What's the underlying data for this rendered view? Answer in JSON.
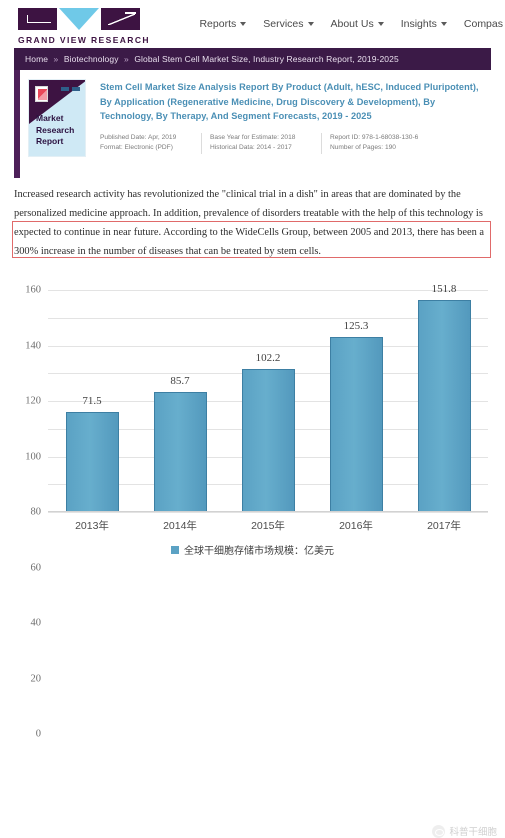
{
  "site": {
    "logo_text": "GRAND VIEW RESEARCH",
    "nav": [
      {
        "label": "Reports",
        "has_caret": true,
        "icon": "chevron-down-icon"
      },
      {
        "label": "Services",
        "has_caret": true,
        "icon": "chevron-down-icon"
      },
      {
        "label": "About Us",
        "has_caret": true,
        "icon": "chevron-down-icon"
      },
      {
        "label": "Insights",
        "has_caret": true,
        "icon": "chevron-down-icon"
      },
      {
        "label": "Compas",
        "has_caret": false,
        "icon": ""
      }
    ],
    "accent_purple": "#3b1a47",
    "accent_cyan": "#6fc9e8",
    "link_blue": "#4a8fb5"
  },
  "breadcrumb": {
    "items": [
      "Home",
      "Biotechnology",
      "Global Stem Cell Market Size, Industry Research Report, 2019-2025"
    ],
    "separator": "»"
  },
  "report": {
    "thumb_title": "Market\nResearch\nReport",
    "thumb_line1": "Market",
    "thumb_line2": "Research",
    "thumb_line3": "Report",
    "title": "Stem Cell Market Size Analysis Report By Product (Adult, hESC, Induced Pluripotent), By Application (Regenerative Medicine, Drug Discovery & Development), By Technology, By Therapy, And Segment Forecasts, 2019 - 2025",
    "meta": {
      "published_date": "Published Date: Apr, 2019",
      "base_year": "Base Year for Estimate: 2018",
      "report_id": "Report ID: 978-1-68038-130-6",
      "format": "Format: Electronic (PDF)",
      "historical_data": "Historical Data: 2014 - 2017",
      "pages": "Number of Pages: 190"
    }
  },
  "body_text": {
    "paragraph": "Increased research activity has revolutionized the \"clinical trial in a dish\" in areas that are dominated by the personalized medicine approach. In addition, prevalence of disorders treatable with the help of this technology is expected to continue in near future. According to the WideCells Group, between 2005 and 2013, there has been a 300% increase in the number of diseases that can be treated by stem cells.",
    "highlight_color": "#e06a6a"
  },
  "chart_data": {
    "type": "bar",
    "title": "",
    "categories": [
      "2013年",
      "2014年",
      "2015年",
      "2016年",
      "2017年"
    ],
    "values": [
      71.5,
      85.7,
      102.2,
      125.3,
      151.8
    ],
    "value_labels": [
      "71.5",
      "85.7",
      "102.2",
      "125.3",
      "151.8"
    ],
    "series": [
      {
        "name": "全球干细胞存储市场规模：亿美元",
        "values": [
          71.5,
          85.7,
          102.2,
          125.3,
          151.8
        ]
      }
    ],
    "legend": [
      "全球干细胞存储市场规模：亿美元"
    ],
    "legend_position": "bottom",
    "xlabel": "",
    "ylabel": "",
    "ylim": [
      0,
      160
    ],
    "ytick_step": 20,
    "yticks": [
      160,
      140,
      120,
      100,
      80,
      60,
      40,
      20,
      0
    ],
    "ytick_labels": [
      "160",
      "140",
      "120",
      "100",
      "80",
      "60",
      "40",
      "20",
      "0"
    ],
    "grid": true,
    "bar_color": "#5ba2c4",
    "bar_border_color": "#3d7fa3"
  },
  "watermark": {
    "text": "科普干细胞",
    "icon": "wechat-account-icon"
  }
}
